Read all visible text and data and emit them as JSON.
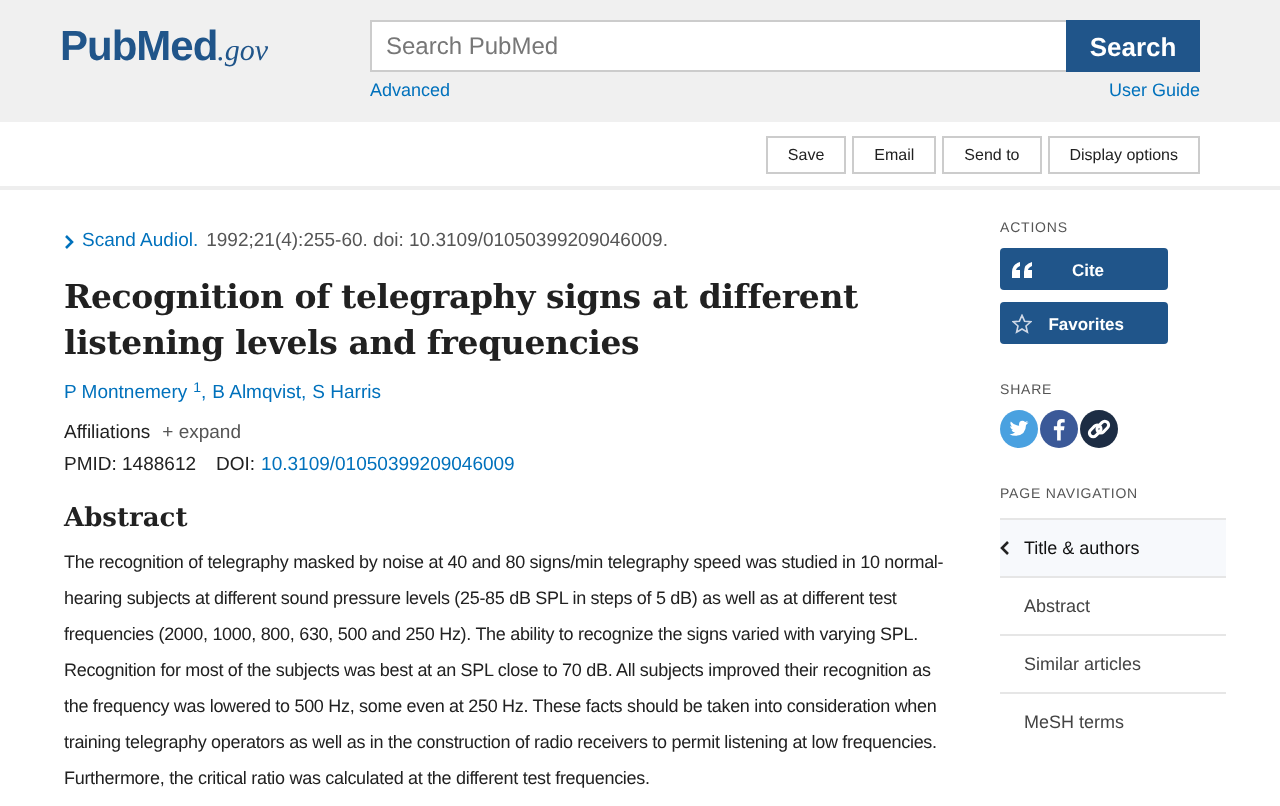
{
  "header": {
    "logo": {
      "name": "PubMed",
      "suffix": ".gov"
    },
    "search": {
      "placeholder": "Search PubMed",
      "button": "Search"
    },
    "links": [
      "Advanced",
      "User Guide"
    ]
  },
  "toolbar": [
    "Save",
    "Email",
    "Send to",
    "Display options"
  ],
  "article": {
    "journal": "Scand Audiol.",
    "citation": "1992;21(4):255-60. doi: 10.3109/01050399209046009.",
    "title": "Recognition of telegraphy signs at different listening levels and frequencies",
    "authors": [
      {
        "name": "P Montnemery",
        "mark": "1",
        "separator": ","
      },
      {
        "name": "B Almqvist",
        "separator": ","
      },
      {
        "name": "S Harris"
      }
    ],
    "affiliations": {
      "label": "Affiliations",
      "toggle": "+ expand"
    },
    "pmid": "PMID: 1488612",
    "doi_label": "DOI:",
    "doi": "10.3109/01050399209046009",
    "abstract_heading": "Abstract",
    "abstract": "The recognition of telegraphy masked by noise at 40 and 80 signs/min telegraphy speed was studied in 10 normal-hearing subjects at different sound pressure levels (25-85 dB SPL in steps of 5 dB) as well as at different test frequencies (2000, 1000, 800, 630, 500 and 250 Hz). The ability to recognize the signs varied with varying SPL. Recognition for most of the subjects was best at an SPL close to 70 dB. All subjects improved their recognition as the frequency was lowered to 500 Hz, some even at 250 Hz. These facts should be taken into consideration when training telegraphy operators as well as in the construction of radio receivers to permit listening at low frequencies. Furthermore, the critical ratio was calculated at the different test frequencies."
  },
  "sidebar": {
    "actions_heading": "ACTIONS",
    "actions": [
      {
        "kind": "cite",
        "label": "Cite"
      },
      {
        "kind": "favorites",
        "label": "Favorites"
      }
    ],
    "share_heading": "SHARE",
    "share": [
      {
        "kind": "twitter"
      },
      {
        "kind": "facebook"
      },
      {
        "kind": "link"
      }
    ],
    "nav_heading": "PAGE NAVIGATION",
    "nav": [
      {
        "label": "Title & authors",
        "selected": true
      },
      {
        "label": "Abstract",
        "selected": false
      },
      {
        "label": "Similar articles",
        "selected": false
      },
      {
        "label": "MeSH terms",
        "selected": false
      }
    ]
  }
}
